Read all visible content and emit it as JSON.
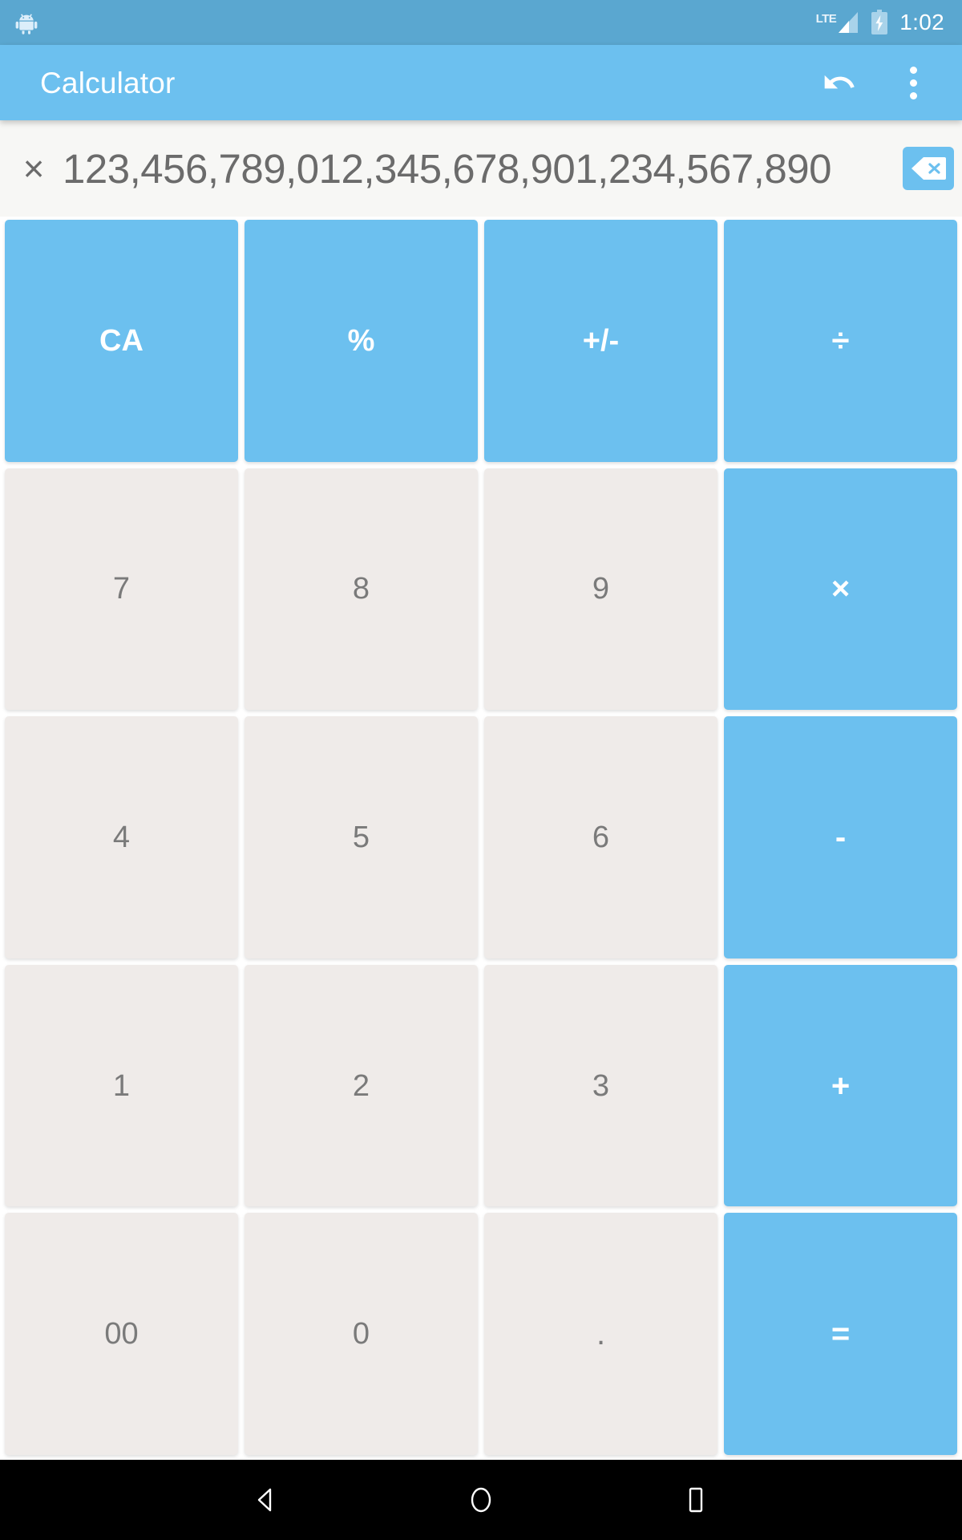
{
  "status_bar": {
    "notification_icon": "android-robot-icon",
    "network_label": "LTE",
    "signal_icon": "signal-bars-icon",
    "battery_icon": "battery-charging-icon",
    "time": "1:02",
    "background_color": "#5aa7d0"
  },
  "app_bar": {
    "title": "Calculator",
    "undo_icon": "undo-icon",
    "overflow_icon": "overflow-menu-icon",
    "background_color": "#6cc0ef",
    "title_color": "#ffffff"
  },
  "display": {
    "operator": "×",
    "value": "123,456,789,012,345,678,901,234,567,890",
    "backspace_icon": "backspace-icon",
    "background_color": "#f7f7f5",
    "text_color": "#6b6b6b"
  },
  "keypad": {
    "accent_color": "#6cc0ef",
    "number_key_color": "#efebe9",
    "number_text_color": "#7a7a7a",
    "rows": [
      [
        {
          "label": "CA",
          "type": "op",
          "name": "clear-all-button"
        },
        {
          "label": "%",
          "type": "op",
          "name": "percent-button"
        },
        {
          "label": "+/-",
          "type": "op",
          "name": "sign-toggle-button"
        },
        {
          "label": "÷",
          "type": "op",
          "name": "divide-button"
        }
      ],
      [
        {
          "label": "7",
          "type": "num",
          "name": "digit-7-button"
        },
        {
          "label": "8",
          "type": "num",
          "name": "digit-8-button"
        },
        {
          "label": "9",
          "type": "num",
          "name": "digit-9-button"
        },
        {
          "label": "×",
          "type": "op",
          "name": "multiply-button"
        }
      ],
      [
        {
          "label": "4",
          "type": "num",
          "name": "digit-4-button"
        },
        {
          "label": "5",
          "type": "num",
          "name": "digit-5-button"
        },
        {
          "label": "6",
          "type": "num",
          "name": "digit-6-button"
        },
        {
          "label": "-",
          "type": "op",
          "name": "subtract-button"
        }
      ],
      [
        {
          "label": "1",
          "type": "num",
          "name": "digit-1-button"
        },
        {
          "label": "2",
          "type": "num",
          "name": "digit-2-button"
        },
        {
          "label": "3",
          "type": "num",
          "name": "digit-3-button"
        },
        {
          "label": "+",
          "type": "op",
          "name": "add-button"
        }
      ],
      [
        {
          "label": "00",
          "type": "num",
          "name": "double-zero-button"
        },
        {
          "label": "0",
          "type": "num",
          "name": "digit-0-button"
        },
        {
          "label": ".",
          "type": "num",
          "name": "decimal-point-button"
        },
        {
          "label": "=",
          "type": "op",
          "name": "equals-button"
        }
      ]
    ]
  },
  "nav_bar": {
    "back_icon": "back-triangle-icon",
    "home_icon": "home-circle-icon",
    "recents_icon": "recents-square-icon",
    "background_color": "#000000"
  }
}
